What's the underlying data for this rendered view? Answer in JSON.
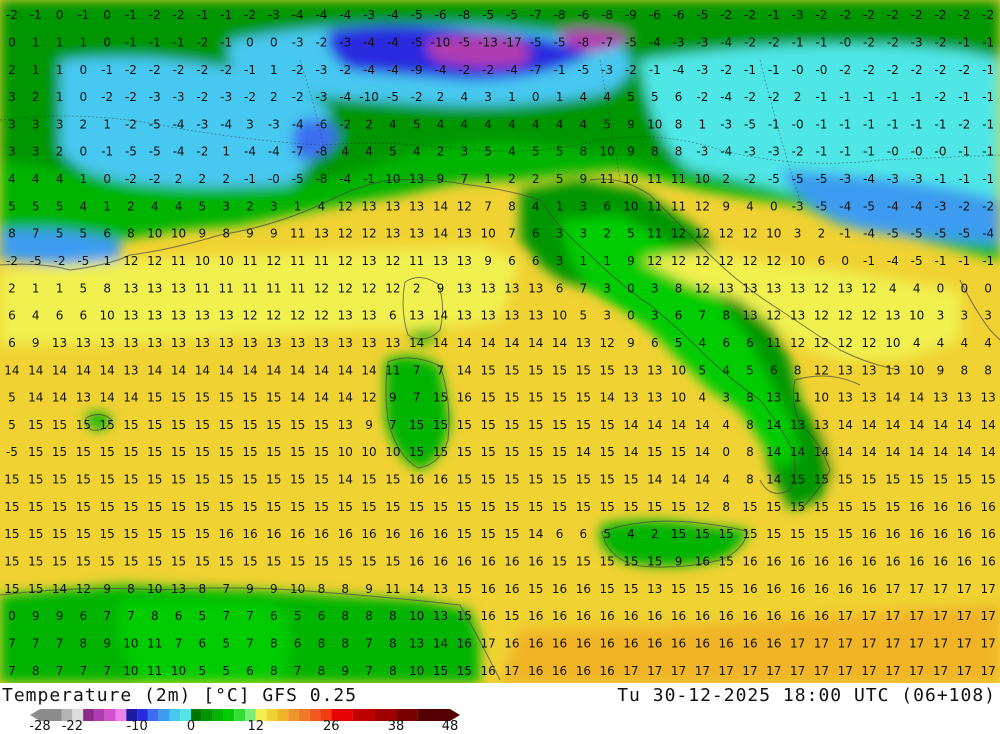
{
  "header": {
    "title": "Temperature (2m) [°C] GFS 0.25",
    "valid_time": "Tu 30-12-2025 18:00 UTC (06+108)"
  },
  "legend": {
    "tick_labels": [
      "-28",
      "-22",
      "-10",
      "0",
      "12",
      "26",
      "38",
      "48"
    ],
    "tick_values": [
      -28,
      -22,
      -10,
      0,
      12,
      26,
      38,
      48
    ],
    "range": [
      -28,
      48
    ],
    "colors": [
      {
        "from": -28,
        "to": -24,
        "color": "#8c8c8c"
      },
      {
        "from": -24,
        "to": -22,
        "color": "#b4b4b4"
      },
      {
        "from": -22,
        "to": -20,
        "color": "#dcdcdc"
      },
      {
        "from": -20,
        "to": -18,
        "color": "#8a2b8a"
      },
      {
        "from": -18,
        "to": -16,
        "color": "#b03cb0"
      },
      {
        "from": -16,
        "to": -14,
        "color": "#d050d0"
      },
      {
        "from": -14,
        "to": -12,
        "color": "#ee80ee"
      },
      {
        "from": -12,
        "to": -10,
        "color": "#1a1aa0"
      },
      {
        "from": -10,
        "to": -8,
        "color": "#2a2ae0"
      },
      {
        "from": -8,
        "to": -6,
        "color": "#3c6ef0"
      },
      {
        "from": -6,
        "to": -4,
        "color": "#3c9cf0"
      },
      {
        "from": -4,
        "to": -2,
        "color": "#46c8f0"
      },
      {
        "from": -2,
        "to": 0,
        "color": "#50e6e6"
      },
      {
        "from": 0,
        "to": 2,
        "color": "#007800"
      },
      {
        "from": 2,
        "to": 4,
        "color": "#009600"
      },
      {
        "from": 4,
        "to": 6,
        "color": "#00b400"
      },
      {
        "from": 6,
        "to": 8,
        "color": "#00cc00"
      },
      {
        "from": 8,
        "to": 10,
        "color": "#32dc32"
      },
      {
        "from": 10,
        "to": 12,
        "color": "#78f078"
      },
      {
        "from": 12,
        "to": 14,
        "color": "#f0f050"
      },
      {
        "from": 14,
        "to": 16,
        "color": "#f0d232"
      },
      {
        "from": 16,
        "to": 18,
        "color": "#f0b428"
      },
      {
        "from": 18,
        "to": 20,
        "color": "#f09628"
      },
      {
        "from": 20,
        "to": 22,
        "color": "#f07828"
      },
      {
        "from": 22,
        "to": 24,
        "color": "#f05a1e"
      },
      {
        "from": 24,
        "to": 26,
        "color": "#f03c14"
      },
      {
        "from": 26,
        "to": 30,
        "color": "#e60000"
      },
      {
        "from": 30,
        "to": 34,
        "color": "#c00000"
      },
      {
        "from": 34,
        "to": 38,
        "color": "#a00000"
      },
      {
        "from": 38,
        "to": 42,
        "color": "#7a0000"
      },
      {
        "from": 42,
        "to": 48,
        "color": "#550000"
      }
    ]
  },
  "grid_rows": [
    "-2 -1 0 -1 0 -1 -2 -2 -1 -1 -2 -3 -4 -4 -4 -3 -4 -5 -6 -8 -5 -5 -7 -8 -6 -8 -9 -6 -6 -5 -2 -2 -1 -3 -2 -2 -2 -2 -2 -2 -2 -2",
    "0 1 1 1 0 -1 -1 -1 -2 -1 0 0 -3 -2 -3 -4 -4 -5 -10 -5 -13 -17 -5 -5 -8 -7 -5 -4 -3 -3 -4 -2 -2 -1 -1 -0 -2 -2 -3 -2 -1 -1",
    "2 1 1 0 -1 -2 -2 -2 -2 -2 -1 1 -2 -3 -2 -4 -4 -9 -4 -2 -2 -4 -7 -1 -5 -3 -2 -1 -4 -3 -2 -1 -1 -0 -0 -2 -2 -2 -2 -2 -2 -1",
    "3 2 1 0 -2 -2 -3 -3 -2 -3 -2 2 -2 -3 -4 -10 -5 -2 2 4 3 1 0 1 4 4 5 5 6 -2 -4 -2 -2 2 -1 -1 -1 -1 -1 -2 -1 -1",
    "3 3 3 2 1 -2 -5 -4 -3 -4 3 -3 -4 -6 -2 2 4 5 4 4 4 4 4 4 4 5 9 10 8 1 -3 -5 -1 -0 -1 -1 -1 -1 -1 -1 -2 -1",
    "3 3 2 0 -1 -5 -5 -4 -2 1 -4 -4 -7 -8 4 4 5 4 2 3 5 4 5 5 8 10 9 8 8 -3 -4 -3 -3 -2 -1 -1 -1 -0 -0 -0 -1 -1",
    "4 4 4 1 0 -2 -2 2 2 2 -1 -0 -5 -8 -4 -1 10 13 9 7 1 2 2 5 9 11 10 11 11 10 2 -2 -5 -5 -5 -3 -4 -3 -3 -1 -1 -1",
    "5 5 5 4 1 2 4 4 5 3 2 3 1 4 12 13 13 13 14 12 7 8 4 1 3 6 10 11 11 12 9 4 0 -3 -5 -4 -5 -4 -4 -3 -2 -2",
    "8 7 5 5 6 8 10 10 9 8 9 9 11 13 12 12 13 13 14 13 10 7 6 3 3 2 5 11 12 12 12 12 10 3 2 -1 -4 -5 -5 -5 -5 -4",
    "-2 -5 -2 -5 1 12 12 11 10 10 11 12 11 11 12 13 12 11 13 13 9 6 6 3 1 1 9 12 12 12 12 12 12 10 6 0 -1 -4 -5 -1 -1 -1",
    "2 1 1 5 8 13 13 13 11 11 11 11 11 12 12 12 12 2 9 13 13 13 13 6 7 3 0 3 8 12 13 13 13 13 12 13 12 4 4 0 0 0",
    "6 4 6 6 10 13 13 13 13 13 12 12 12 12 13 13 6 13 14 13 13 13 13 10 5 3 0 3 6 7 8 13 12 13 12 12 12 13 10 3 3 3",
    "6 9 13 13 13 13 13 13 13 13 13 13 13 13 13 13 13 14 14 14 14 14 14 14 13 12 9 6 5 4 6 6 11 12 12 12 12 10 4 4 4 4",
    "14 14 14 14 14 13 14 14 14 14 14 14 14 14 14 14 11 7 7 14 15 15 15 15 15 15 13 13 10 5 4 5 6 8 12 13 13 13 10 9 8 8",
    "5 14 14 13 14 14 15 15 15 15 15 15 14 14 14 12 9 7 15 16 15 15 15 15 15 14 13 13 10 4 3 8 13 1 10 13 13 14 14 13 13 13",
    "5 15 15 15 15 15 15 15 15 15 15 15 15 15 13 9 7 15 15 15 15 15 15 15 15 15 14 14 14 14 4 8 14 13 13 14 14 14 14 14 14 14",
    "-5 15 15 15 15 15 15 15 15 15 15 15 15 15 10 10 10 15 15 15 15 15 15 15 14 15 14 15 15 14 0 8 14 14 14 14 14 14 14 14 14 14",
    "15 15 15 15 15 15 15 15 15 15 15 15 15 15 14 15 15 16 16 15 15 15 15 15 15 15 15 14 14 14 4 8 14 15 15 15 15 15 15 15 15 15",
    "15 15 15 15 15 15 15 15 15 15 15 15 15 15 15 15 15 15 15 15 15 15 15 15 15 15 15 15 15 12 8 15 15 15 15 15 15 15 16 16 16 16",
    "15 15 15 15 15 15 15 15 15 16 16 16 16 16 16 16 16 16 16 15 15 15 14 6 6 5 4 2 15 15 15 15 15 15 15 15 16 16 16 16 16 16",
    "15 15 15 15 15 15 15 15 15 15 15 15 15 15 15 15 15 16 16 16 16 16 16 15 15 15 15 15 9 16 15 16 16 16 16 16 16 16 16 16 16 16",
    "15 15 14 12 9 8 10 13 8 7 9 9 10 8 8 9 11 14 13 15 16 16 15 16 16 15 15 13 15 15 15 16 16 16 16 16 16 17 17 17 17 17",
    "0 9 9 6 7 7 8 6 5 7 7 6 5 6 8 8 8 10 13 15 16 15 16 16 16 16 16 16 16 16 16 16 16 16 16 17 17 17 17 17 17 17",
    "7 7 7 8 9 10 11 7 6 5 7 8 6 8 8 7 8 13 14 16 17 16 16 16 16 16 16 16 16 16 16 16 16 17 17 17 17 17 17 17 17 17",
    "7 8 7 7 7 10 11 10 5 5 6 8 7 8 9 7 8 10 15 15 16 17 16 16 16 16 17 17 17 17 17 17 17 17 17 17 17 17 17 17 17 17"
  ]
}
